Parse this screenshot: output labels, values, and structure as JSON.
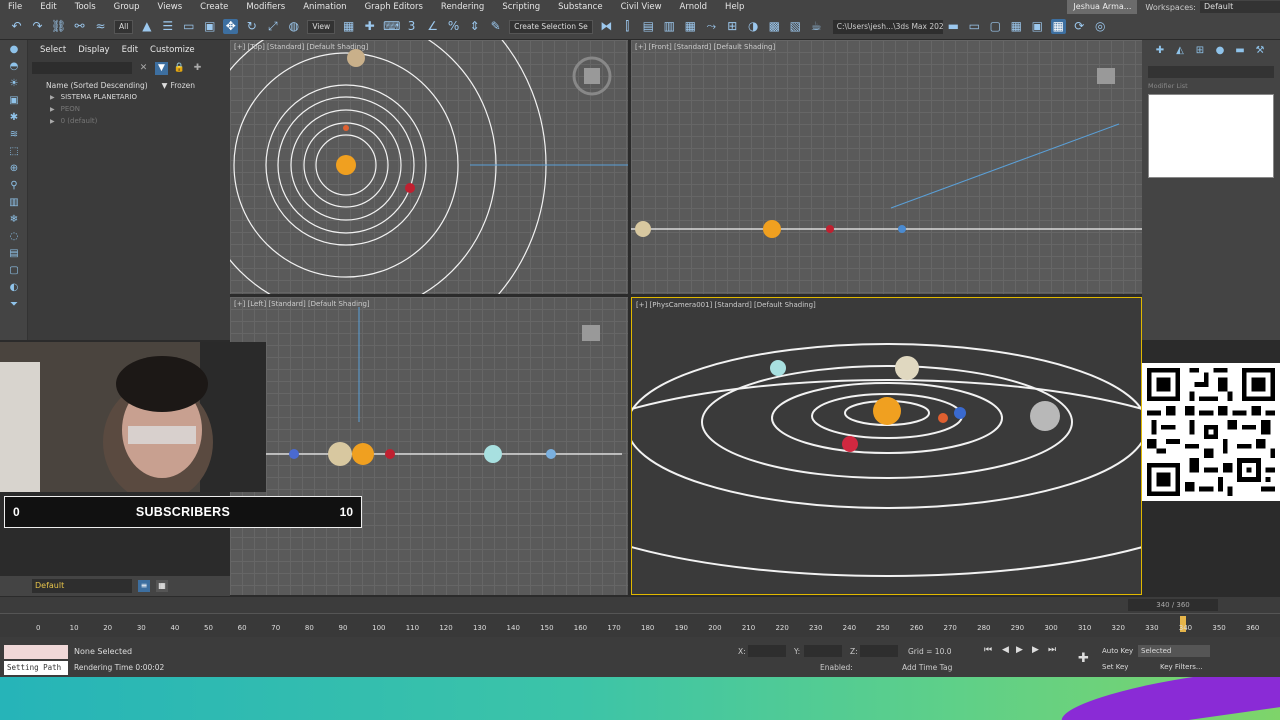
{
  "menu": [
    "File",
    "Edit",
    "Tools",
    "Group",
    "Views",
    "Create",
    "Modifiers",
    "Animation",
    "Graph Editors",
    "Rendering",
    "Scripting",
    "Substance",
    "Civil View",
    "Arnold",
    "Help"
  ],
  "user": "Jeshua Arma...",
  "workspace_label": "Workspaces:",
  "workspace_value": "Default",
  "toolbar": {
    "filter": "All",
    "view": "View",
    "selection_set": "Create Selection Se",
    "path": "C:\\Users\\jesh...\\3ds Max 202"
  },
  "explorer": {
    "tabs": [
      "Select",
      "Display",
      "Edit",
      "Customize"
    ],
    "col_name": "Name (Sorted Descending)",
    "col_frozen": "Frozen",
    "rows": [
      "SISTEMA PLANETARIO",
      "PEON",
      "0 (default)"
    ]
  },
  "viewports": {
    "top": "[+] [Top] [Standard] [Default Shading]",
    "front": "[+] [Front] [Standard] [Default Shading]",
    "left": "[+] [Left] [Standard] [Default Shading]",
    "camera": "[+] [PhysCamera001] [Standard] [Default Shading]"
  },
  "command_panel": {
    "modifier_list": "Modifier List"
  },
  "subscribers": {
    "low": "0",
    "label": "SUBSCRIBERS",
    "high": "10"
  },
  "layer": "Default",
  "timeline": {
    "frame": "340 / 360",
    "ticks": [
      "0",
      "10",
      "20",
      "30",
      "40",
      "50",
      "60",
      "70",
      "80",
      "90",
      "100",
      "110",
      "120",
      "130",
      "140",
      "150",
      "160",
      "170",
      "180",
      "190",
      "200",
      "210",
      "220",
      "230",
      "240",
      "250",
      "260",
      "270",
      "280",
      "290",
      "300",
      "310",
      "320",
      "330",
      "340",
      "350",
      "360"
    ]
  },
  "status": {
    "selection": "None Selected",
    "render_time": "Rendering Time  0:00:02",
    "setting_path": "Setting Path",
    "x": "X:",
    "y": "Y:",
    "z": "Z:",
    "grid": "Grid = 10.0",
    "enabled": "Enabled:",
    "add_time_tag": "Add Time Tag",
    "auto_key": "Auto Key",
    "set_key": "Set Key",
    "selected": "Selected",
    "key_filters": "Key Filters...",
    "frame_field": "340"
  }
}
